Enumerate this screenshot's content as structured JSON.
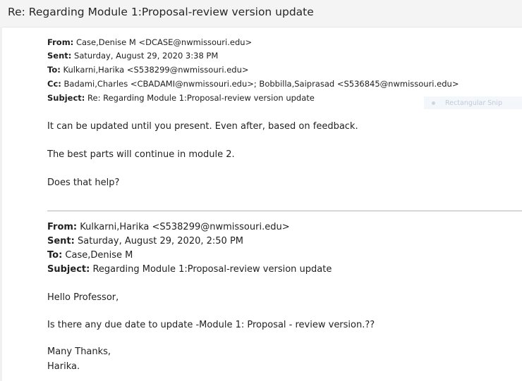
{
  "subject": "Re: Regarding Module 1:Proposal-review version update",
  "reply": {
    "from_label": "From:",
    "from_value": "Case,Denise M <DCASE@nwmissouri.edu>",
    "sent_label": "Sent:",
    "sent_value": "Saturday, August 29, 2020 3:38 PM",
    "to_label": "To:",
    "to_value": "Kulkarni,Harika <S538299@nwmissouri.edu>",
    "cc_label": "Cc:",
    "cc_value": "Badami,Charles <CBADAMI@nwmissouri.edu>; Bobbilla,Saiprasad <S536845@nwmissouri.edu>",
    "subject_label": "Subject:",
    "subject_value": "Re: Regarding Module 1:Proposal-review version update",
    "body": [
      "It can be updated until you present. Even after, based on feedback.",
      "The best parts will continue in module 2.",
      "Does that help?"
    ]
  },
  "snip_overlay": {
    "label": "Rectangular Snip"
  },
  "quoted": {
    "from_label": "From:",
    "from_value": "Kulkarni,Harika <S538299@nwmissouri.edu>",
    "sent_label": "Sent:",
    "sent_value": "Saturday, August 29, 2020, 2:50 PM",
    "to_label": "To:",
    "to_value": "Case,Denise M",
    "subject_label": "Subject:",
    "subject_value": "Regarding Module 1:Proposal-review version update",
    "greeting": "Hello Professor,",
    "question": "Is there any due date to update -Module 1: Proposal - review version.??",
    "signoff": "Many Thanks,",
    "signature": "Harika."
  }
}
